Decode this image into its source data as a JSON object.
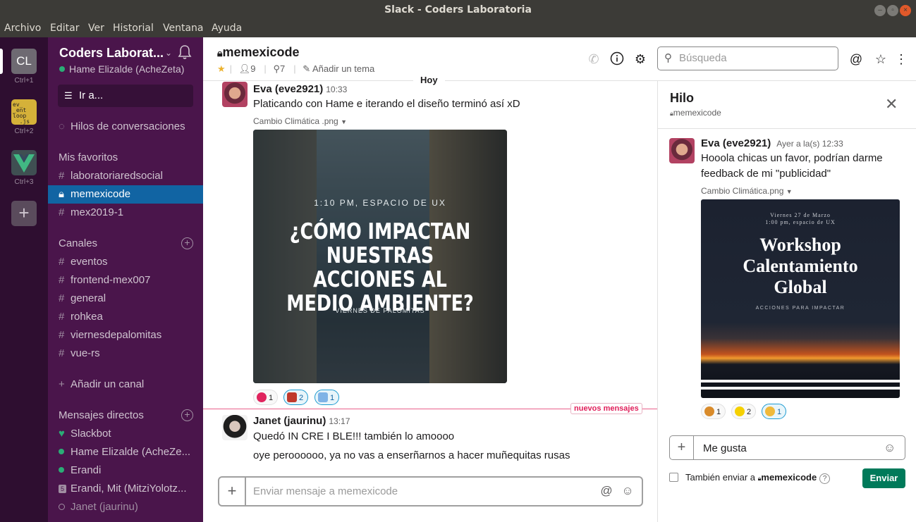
{
  "window": {
    "title": "Slack - Coders Laboratoria"
  },
  "menu": [
    "Archivo",
    "Editar",
    "Ver",
    "Historial",
    "Ventana",
    "Ayuda"
  ],
  "workspaces": [
    {
      "initials": "CL",
      "shortcut": "Ctrl+1"
    },
    {
      "shortcut": "Ctrl+2"
    },
    {
      "shortcut": "Ctrl+3"
    }
  ],
  "sidebar": {
    "team_name": "Coders Laborat...",
    "user_status": "Hame Elizalde (AcheZeta)",
    "jump_label": "Ir a...",
    "threads_label": "Hilos de conversaciones",
    "favorites_header": "Mis favoritos",
    "favorites": [
      {
        "prefix": "#",
        "label": "laboratoriaredsocial"
      },
      {
        "prefix": "lock",
        "label": "memexicode"
      },
      {
        "prefix": "#",
        "label": "mex2019-1"
      }
    ],
    "channels_header": "Canales",
    "channels": [
      "eventos",
      "frontend-mex007",
      "general",
      "rohkea",
      "viernesdepalomitas",
      "vue-rs"
    ],
    "add_channel": "Añadir un canal",
    "dm_header": "Mensajes directos",
    "dms": [
      {
        "label": "Slackbot",
        "status": "heart"
      },
      {
        "label": "Hame Elizalde (AcheZe...",
        "status": "online"
      },
      {
        "label": "Erandi",
        "status": "online"
      },
      {
        "label": "Erandi, Mit (MitziYolotz...",
        "status": "group",
        "count": "5"
      },
      {
        "label": "Janet (jaurinu)",
        "status": "away"
      }
    ]
  },
  "channel": {
    "name": "memexicode",
    "members": "9",
    "pins": "7",
    "add_topic": "Añadir un tema",
    "search_placeholder": "Búsqueda"
  },
  "messages": {
    "day": "Hoy",
    "m1": {
      "author": "Eva (eve2921)",
      "time": "10:33",
      "text": "Platicando con Hame e iterando el diseño terminó así xD",
      "file": "Cambio Climática .png",
      "poster": {
        "top": "1:10 PM, ESPACIO DE UX",
        "line1": "¿CÓMO IMPACTAN",
        "line2": "NUESTRAS ACCIONES AL",
        "line3": "MEDIO AMBIENTE?",
        "bottom": "VIERNES DE PALOMITAS"
      },
      "reactions": [
        {
          "emoji": "heart",
          "count": "1",
          "mine": false
        },
        {
          "emoji": "person",
          "count": "2",
          "mine": true
        },
        {
          "emoji": "robot",
          "count": "1",
          "mine": true
        }
      ]
    },
    "new_label": "nuevos mensajes",
    "m2": {
      "author": "Janet (jaurinu)",
      "time": "13:17",
      "text1": "Quedó IN CRE I BLE!!! también lo amoooo",
      "text2": "oye peroooooo, ya no vas a enserñarnos a hacer muñequitas rusas"
    },
    "composer_placeholder": "Enviar mensaje a memexicode"
  },
  "thread": {
    "title": "Hilo",
    "channel": "memexicode",
    "author": "Eva (eve2921)",
    "time": "Ayer a la(s) 12:33",
    "text1": "Hooola chicas un favor, podrían darme",
    "text2": "feedback de mi \"publicidad\"",
    "file": "Cambio Climática.png",
    "poster": {
      "date1": "Viernes 27 de Marzo",
      "date2": "1:00 pm, espacio de UX",
      "line1": "Workshop",
      "line2": "Calentamiento",
      "line3": "Global",
      "sub": "ACCIONES PARA IMPACTAR"
    },
    "reactions": [
      {
        "emoji": "lion",
        "count": "1",
        "mine": false
      },
      {
        "emoji": "pikachu",
        "count": "2",
        "mine": false
      },
      {
        "emoji": "cat-face",
        "count": "1",
        "mine": true
      }
    ],
    "reply_value": "Me gusta",
    "also_send": "También enviar a",
    "also_channel": "memexicode",
    "send_label": "Enviar"
  },
  "colors": {
    "sidebar": "#4a154b",
    "active": "#1164a3",
    "send": "#007a5a",
    "new_messages": "#e01e5a"
  }
}
